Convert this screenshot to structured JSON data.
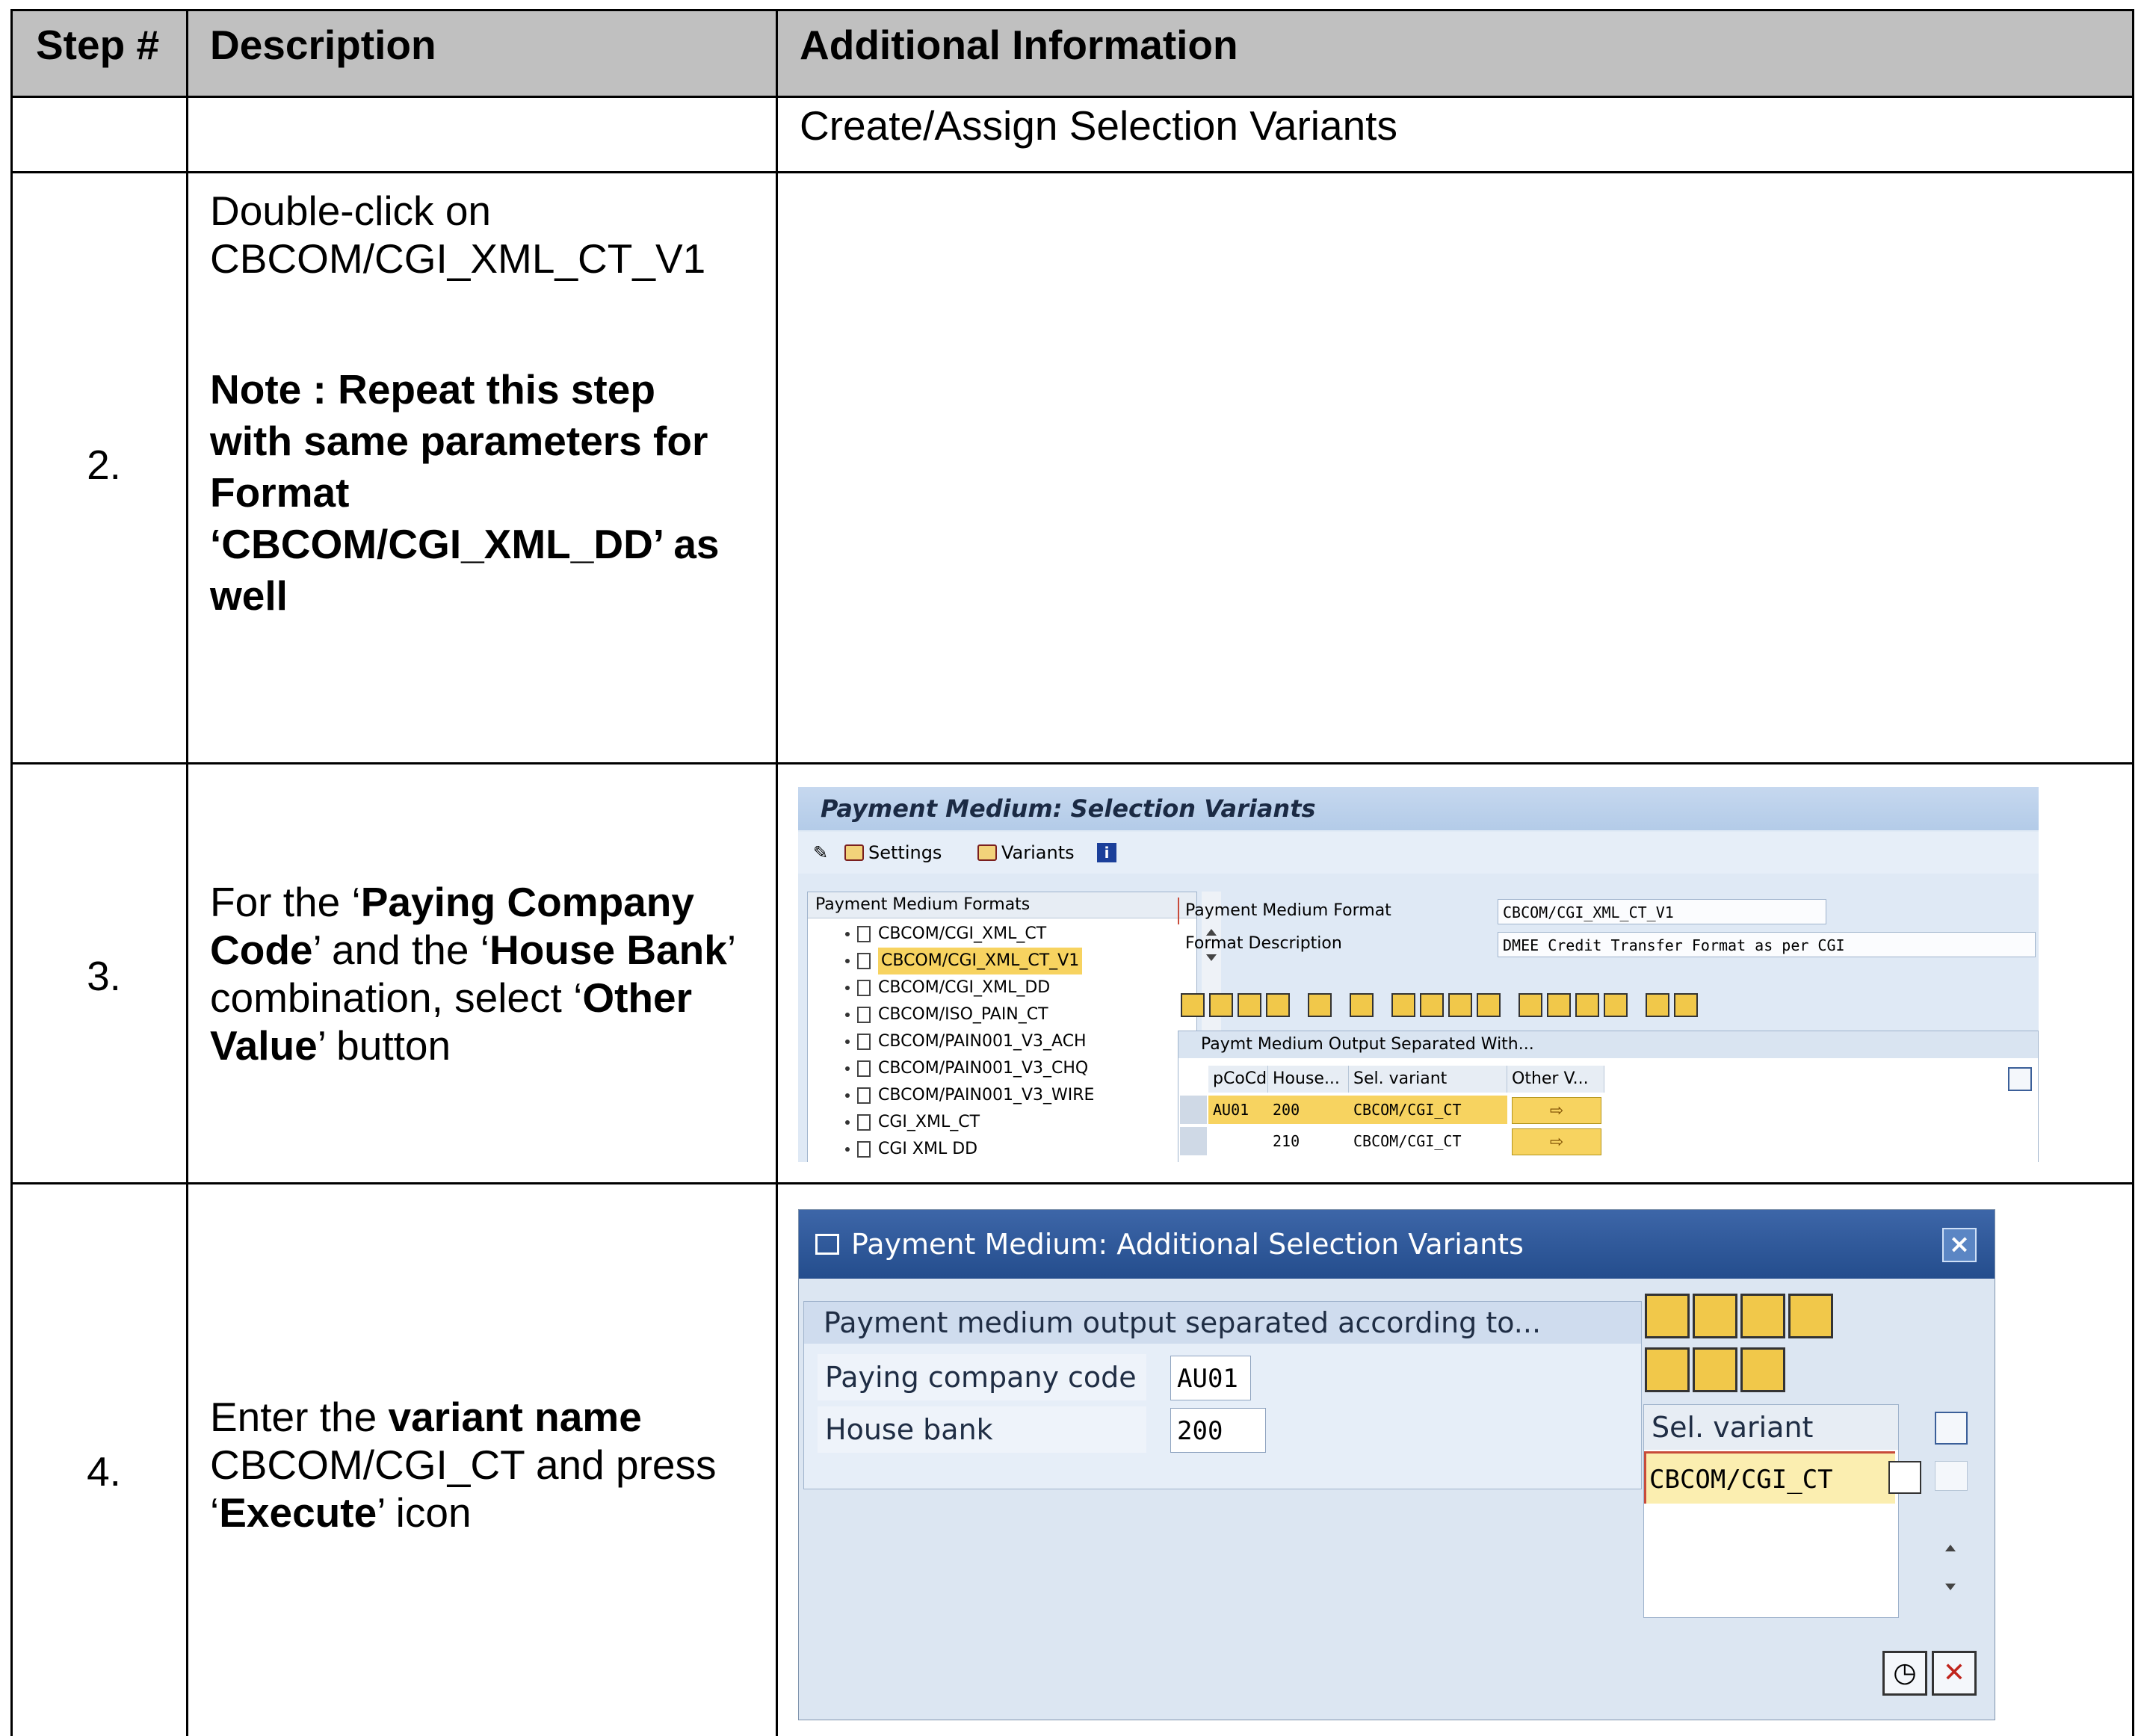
{
  "table": {
    "headers": [
      "Step #",
      "Description",
      "Additional Information"
    ],
    "row1": {
      "additional": "Create/Assign Selection Variants"
    },
    "row2": {
      "step": "2.",
      "desc_line1": "Double-click on",
      "desc_line2": "CBCOM/CGI_XML_CT_V1",
      "note_lines": [
        "Note :  Repeat this step",
        "with same parameters for",
        "Format",
        "‘CBCOM/CGI_XML_DD’ as",
        "well"
      ]
    },
    "row3": {
      "step": "3.",
      "desc": {
        "p1": "For the ‘",
        "b1": "Paying Company",
        "b2": "Code",
        "p2": "’ and the ‘",
        "b3": "House Bank",
        "p3": "’",
        "p4": "combination, select ‘",
        "b4": "Other",
        "b5": "Value",
        "p5": "’ button"
      }
    },
    "row4": {
      "step": "4.",
      "desc": {
        "p1": "Enter the ",
        "b1": "variant name",
        "p2": "CBCOM/CGI_CT and press",
        "p3": "‘",
        "b2": "Execute",
        "p4": "’ icon"
      }
    }
  },
  "screen1": {
    "title": "Payment Medium: Selection Variants",
    "toolbar": {
      "settings": "Settings",
      "variants": "Variants"
    },
    "tree_header": "Payment Medium Formats",
    "tree_items": [
      "CBCOM/CGI_XML_CT",
      "CBCOM/CGI_XML_CT_V1",
      "CBCOM/CGI_XML_DD",
      "CBCOM/ISO_PAIN_CT",
      "CBCOM/PAIN001_V3_ACH",
      "CBCOM/PAIN001_V3_CHQ",
      "CBCOM/PAIN001_V3_WIRE",
      "CGI_XML_CT",
      "CGI XML DD"
    ],
    "selected_item": "CBCOM/CGI_XML_CT_V1",
    "fields": {
      "format_label": "Payment Medium Format",
      "format_value": "CBCOM/CGI_XML_CT_V1",
      "desc_label": "Format Description",
      "desc_value": "DMEE Credit Transfer Format as per CGI"
    },
    "grid": {
      "title": "Paymt Medium Output Separated With...",
      "columns": [
        "pCoCd",
        "House...",
        "Sel. variant",
        "Other V..."
      ],
      "rows": [
        {
          "cocd": "AU01",
          "house": "200",
          "variant": "CBCOM/CGI_CT"
        },
        {
          "cocd": "",
          "house": "210",
          "variant": "CBCOM/CGI_CT"
        }
      ]
    },
    "colors": {
      "selection": "#f7d360",
      "title_bg": "#b3cbe8"
    }
  },
  "screen2": {
    "title": "Payment Medium: Additional Selection Variants",
    "group_title": "Payment medium output separated according to...",
    "paying_label": "Paying company code",
    "paying_value": "AU01",
    "bank_label": "House bank",
    "bank_value": "200",
    "variant_header": "Sel. variant",
    "variant_value": "CBCOM/CGI_CT",
    "icons": [
      "cut-icon",
      "copy-icon",
      "paste-icon",
      "delete-icon",
      "insert-icon",
      "append-icon",
      "remove-icon",
      "execute-icon",
      "cancel-icon"
    ],
    "colors": {
      "title_bg": "#244d8d",
      "selected_row": "#fbeeb0"
    }
  }
}
